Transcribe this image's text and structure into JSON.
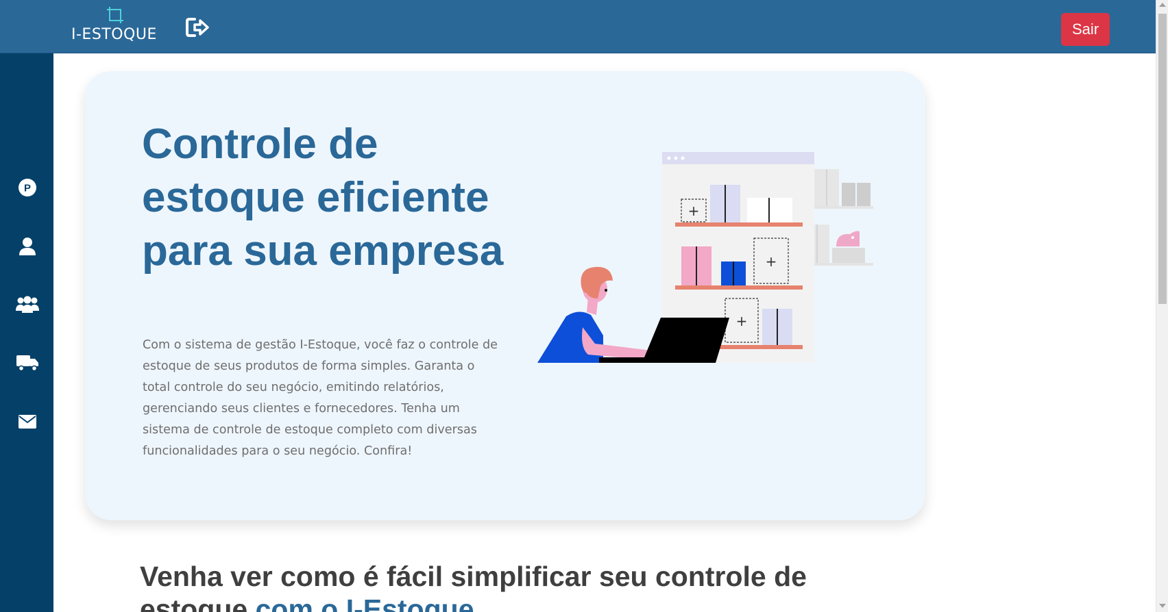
{
  "header": {
    "logo_text": "I-ESTOQUE",
    "logout_icon": "sign-out-icon",
    "exit_label": "Sair",
    "background_color": "#2a6898",
    "exit_color": "#dc3545"
  },
  "sidebar": {
    "background_color": "#044068",
    "items": [
      {
        "icon": "product-p-icon",
        "letter": "P"
      },
      {
        "icon": "user-icon"
      },
      {
        "icon": "users-group-icon"
      },
      {
        "icon": "truck-icon"
      },
      {
        "icon": "envelope-icon"
      }
    ]
  },
  "hero": {
    "title": "Controle de estoque eficiente para sua empresa",
    "description": "Com o sistema de gestão I-Estoque, você faz o controle de estoque de seus produtos de forma simples. Garanta o total controle do seu negócio, emitindo relatórios, gerenciando seus clientes e fornecedores. Tenha um sistema de controle de estoque completo com diversas funcionalidades para o seu negócio. Confira!",
    "illustration": "person-at-laptop-with-stock-shelves-illustration"
  },
  "section2": {
    "heading_main": "Venha ver como é fácil simplificar seu controle de estoque",
    "heading_accent": "com o I-Estoque"
  }
}
